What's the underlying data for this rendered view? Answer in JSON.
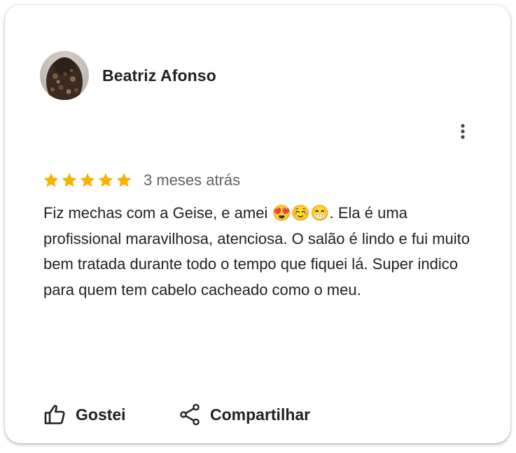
{
  "review": {
    "author_name": "Beatriz Afonso",
    "rating": 5,
    "rating_max": 5,
    "time_ago": "3 meses atrás",
    "text": "Fiz mechas com a Geise, e amei 😍☺️😁. Ela é uma profissional maravilhosa, atenciosa. O salão é lindo e fui muito bem tratada durante todo o tempo que fiquei lá. Super indico para quem tem cabelo cacheado como o meu."
  },
  "actions": {
    "like_label": "Gostei",
    "like_icon": "thumbs-up-icon",
    "share_label": "Compartilhar",
    "share_icon": "share-icon",
    "more_icon": "more-vert-icon"
  },
  "colors": {
    "star": "#f6b400",
    "meta_text": "#5f6368",
    "text": "#202124",
    "card_background": "#ffffff"
  }
}
